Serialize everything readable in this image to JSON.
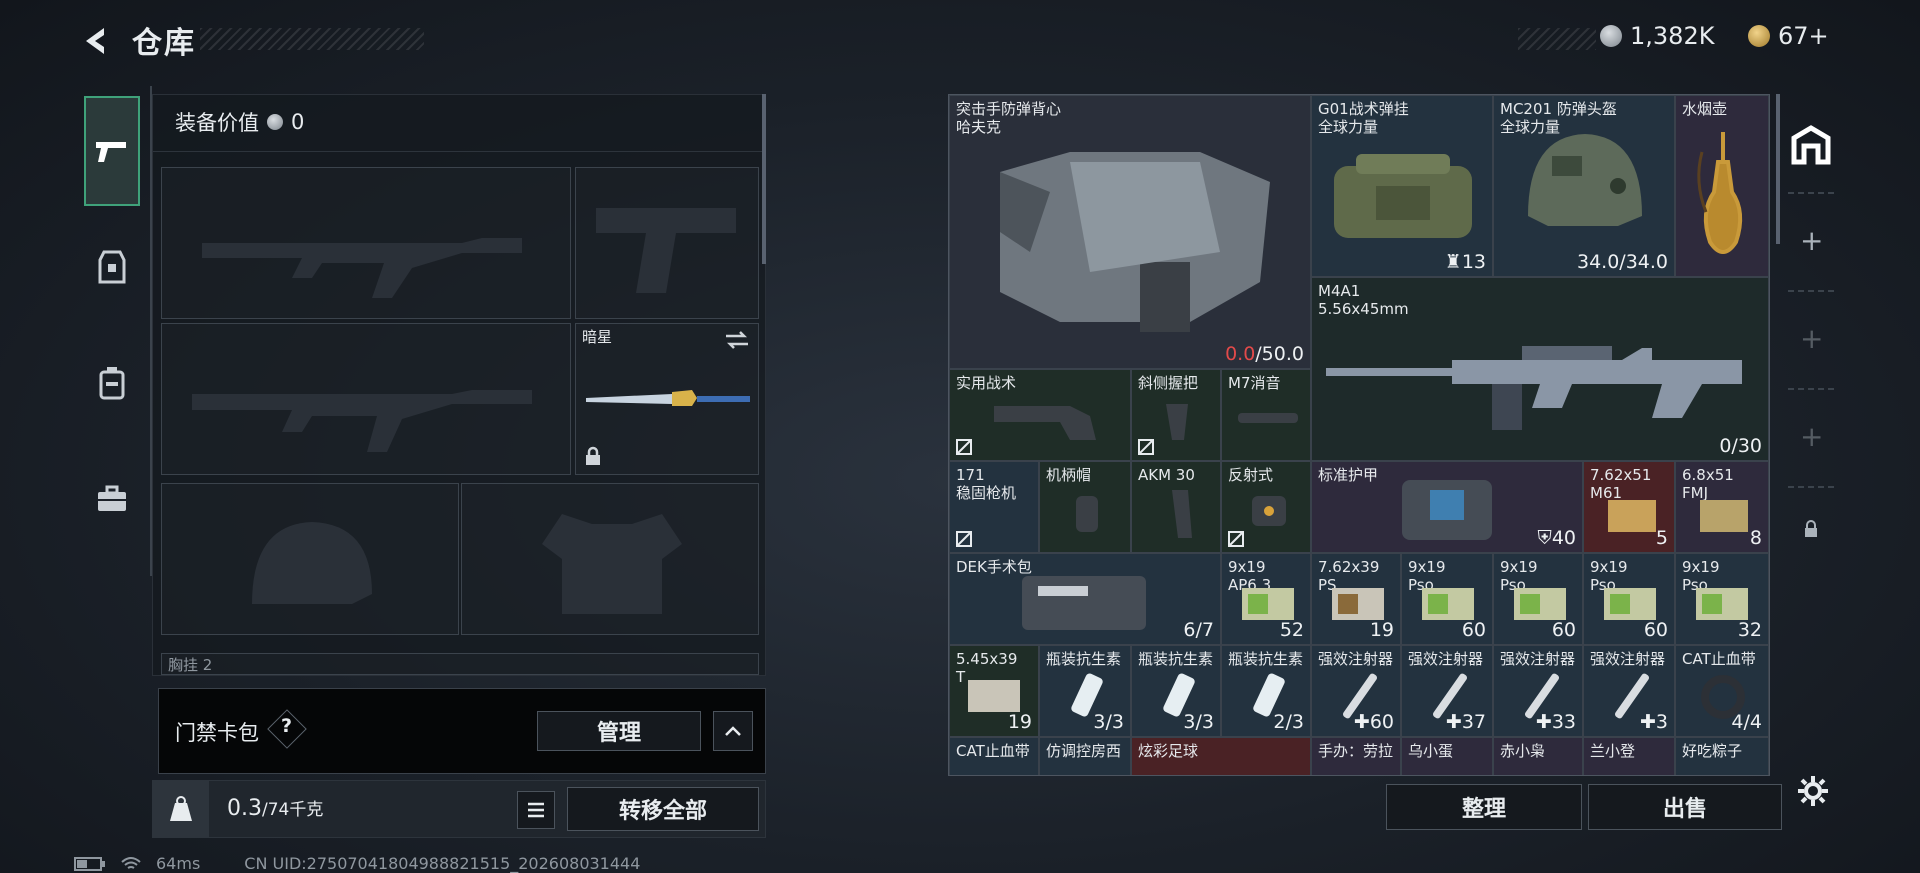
{
  "header": {
    "title": "仓库"
  },
  "currency": {
    "coins": "1,382K",
    "points": "67+"
  },
  "left": {
    "equipment_value_label": "装备价值",
    "equipment_value": "0",
    "melee_name": "暗星",
    "chest_label": "胸挂",
    "chest_value": "2",
    "keycard_label": "门禁卡包",
    "keycard_help": "?",
    "manage_label": "管理",
    "weight_value": "0.3",
    "weight_capacity": "/74千克",
    "transfer_all_label": "转移全部"
  },
  "right": {
    "sort_label": "整理",
    "sell_label": "出售"
  },
  "status": {
    "ping": "64ms",
    "uid": "CN UID:27507041804988821515_202608031444"
  },
  "items": [
    {
      "label": "突击手防弹背心\n哈夫克",
      "count_red": "0.0",
      "count": "/50.0"
    },
    {
      "label": "G01战术弹挂\n全球力量",
      "count": "13"
    },
    {
      "label": "MC201 防弹头盔\n全球力量",
      "count": "34.0/34.0"
    },
    {
      "label": "水烟壶",
      "count": ""
    },
    {
      "label": "M4A1\n5.56x45mm",
      "count": "0/30"
    },
    {
      "label": "实用战术",
      "count": ""
    },
    {
      "label": "斜侧握把",
      "count": ""
    },
    {
      "label": "M7消音",
      "count": ""
    },
    {
      "label": "171\n稳固枪机",
      "count": ""
    },
    {
      "label": "机柄帽",
      "count": ""
    },
    {
      "label": "AKM 30",
      "count": ""
    },
    {
      "label": "反射式",
      "count": ""
    },
    {
      "label": "标准护甲",
      "count": "40"
    },
    {
      "label": "7.62x51\nM61",
      "count": "5"
    },
    {
      "label": "6.8x51\nFMJ",
      "count": "8"
    },
    {
      "label": "DEK手术包",
      "count": "6/7"
    },
    {
      "label": "9x19\nAP6.3",
      "count": "52"
    },
    {
      "label": "7.62x39\nPS",
      "count": "19"
    },
    {
      "label": "9x19\nPso",
      "count": "60"
    },
    {
      "label": "9x19\nPso",
      "count": "60"
    },
    {
      "label": "9x19\nPso",
      "count": "60"
    },
    {
      "label": "9x19\nPso",
      "count": "32"
    },
    {
      "label": "5.45x39\nT",
      "count": "19"
    },
    {
      "label": "瓶装抗生素",
      "count": "3/3"
    },
    {
      "label": "瓶装抗生素",
      "count": "3/3"
    },
    {
      "label": "瓶装抗生素",
      "count": "2/3"
    },
    {
      "label": "强效注射器",
      "count": "60"
    },
    {
      "label": "强效注射器",
      "count": "37"
    },
    {
      "label": "强效注射器",
      "count": "33"
    },
    {
      "label": "强效注射器",
      "count": "3"
    },
    {
      "label": "CAT止血带",
      "count": "4/4"
    },
    {
      "label": "CAT止血带",
      "count": ""
    },
    {
      "label": "仿调控房西",
      "count": ""
    },
    {
      "label": "炫彩足球",
      "count": ""
    },
    {
      "label": "手办：劳拉",
      "count": ""
    },
    {
      "label": "乌小蛋",
      "count": ""
    },
    {
      "label": "赤小枭",
      "count": ""
    },
    {
      "label": "兰小登",
      "count": ""
    },
    {
      "label": "好吃粽子",
      "count": ""
    }
  ],
  "colors": {
    "accent_green": "#33d17a",
    "rarity_green": "#2c3a34",
    "rarity_blue": "#23323f",
    "rarity_purple": "#2e2a3c",
    "rarity_red": "#4a2225"
  }
}
